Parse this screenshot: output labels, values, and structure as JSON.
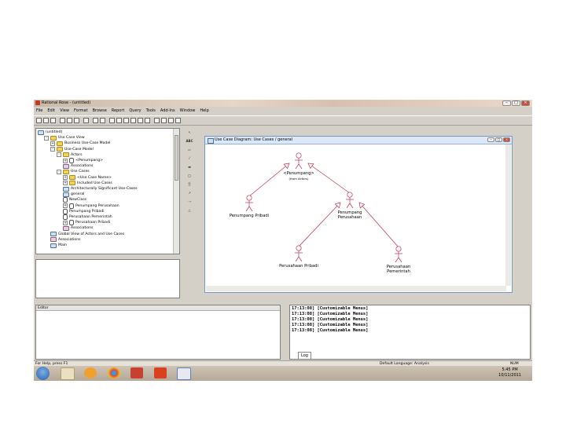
{
  "app": {
    "title": "Rational Rose - (untitled)"
  },
  "menu": [
    "File",
    "Edit",
    "View",
    "Format",
    "Browse",
    "Report",
    "Query",
    "Tools",
    "Add-Ins",
    "Window",
    "Help"
  ],
  "tree": {
    "items": [
      {
        "label": "(untitled)",
        "level": 0,
        "icon": "diagram-icon",
        "exp": ""
      },
      {
        "label": "Use Case View",
        "level": 1,
        "icon": "folder-icon",
        "exp": "-"
      },
      {
        "label": "Business Use-Case Model",
        "level": 2,
        "icon": "folder-icon",
        "exp": "+"
      },
      {
        "label": "Use-Case Model",
        "level": 2,
        "icon": "folder-icon",
        "exp": "-"
      },
      {
        "label": "Actors",
        "level": 3,
        "icon": "folder-icon",
        "exp": "-"
      },
      {
        "label": "<Penumpang>",
        "level": 4,
        "icon": "actor-icon",
        "exp": "+"
      },
      {
        "label": "Associations",
        "level": 4,
        "icon": "association-icon",
        "exp": ""
      },
      {
        "label": "Use Cases",
        "level": 3,
        "icon": "folder-icon",
        "exp": "-"
      },
      {
        "label": "<Use Case Name>",
        "level": 4,
        "icon": "folder-icon",
        "exp": "+"
      },
      {
        "label": "Included Use Cases",
        "level": 4,
        "icon": "folder-icon",
        "exp": "+"
      },
      {
        "label": "Architecturally Significant Use-Cases",
        "level": 4,
        "icon": "diagram-icon",
        "exp": ""
      },
      {
        "label": "general",
        "level": 4,
        "icon": "diagram-icon",
        "exp": ""
      },
      {
        "label": "NewClass",
        "level": 4,
        "icon": "actor-icon",
        "exp": ""
      },
      {
        "label": "Penumpang Perusahaan",
        "level": 4,
        "icon": "actor-icon",
        "exp": "+"
      },
      {
        "label": "Penumpang Pribadi",
        "level": 4,
        "icon": "actor-icon",
        "exp": ""
      },
      {
        "label": "Perusahaan Pemerintah",
        "level": 4,
        "icon": "actor-icon",
        "exp": ""
      },
      {
        "label": "Perusahaan Pribadi",
        "level": 4,
        "icon": "actor-icon",
        "exp": "+"
      },
      {
        "label": "Associations",
        "level": 4,
        "icon": "association-icon",
        "exp": ""
      },
      {
        "label": "Global View of Actors and Use Cases",
        "level": 2,
        "icon": "diagram-icon",
        "exp": ""
      },
      {
        "label": "Associations",
        "level": 2,
        "icon": "association-icon",
        "exp": ""
      },
      {
        "label": "Main",
        "level": 2,
        "icon": "diagram-icon",
        "exp": ""
      }
    ]
  },
  "toolbox": [
    "pointer-icon",
    "ABC",
    "note-icon",
    "anchor-note-icon",
    "package-icon",
    "use-case-icon",
    "actor-icon",
    "unidirectional-association-icon",
    "dependency-icon",
    "generalization-icon"
  ],
  "diagram": {
    "title": "Use Case Diagram: Use Cases / general",
    "actors": [
      {
        "id": "penumpang",
        "label": "<Penumpang>",
        "sublabel": "(from Actors)"
      },
      {
        "id": "pribadi",
        "label": "Penumpang Pribadi"
      },
      {
        "id": "penperus",
        "label": "Penumpang Perusahaan"
      },
      {
        "id": "perpribadi",
        "label": "Perusahaan Pribadi"
      },
      {
        "id": "perpemerintah",
        "label": "Perusahaan Pemerintah"
      }
    ],
    "generalizations": [
      {
        "from": "pribadi",
        "to": "penumpang"
      },
      {
        "from": "penperus",
        "to": "penumpang"
      },
      {
        "from": "perpribadi",
        "to": "penperus"
      },
      {
        "from": "perpemerintah",
        "to": "penperus"
      }
    ]
  },
  "editor": {
    "title": "Editor"
  },
  "log": {
    "lines": [
      "17:13:08]  [Customizable Menus]",
      "17:13:08]  [Customizable Menus]",
      "17:13:08]  [Customizable Menus]",
      "17:13:08]  [Customizable Menus]",
      "17:13:08]  [Customizable Menus]"
    ],
    "tab": "Log"
  },
  "status": {
    "help": "For Help, press F1",
    "language": "Default Language: Analysis",
    "num": "NUM"
  },
  "clock": {
    "time": "5:45 PM",
    "date": "10/11/2011"
  }
}
